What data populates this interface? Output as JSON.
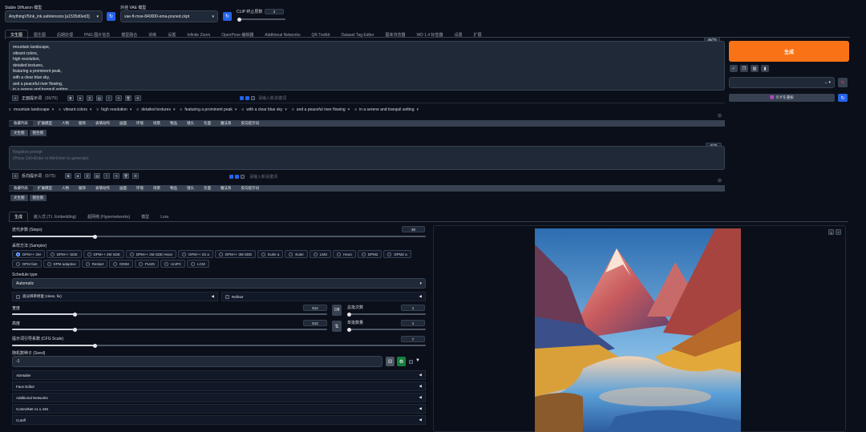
{
  "header": {
    "checkpoint_label": "Stable Diffusion 模型",
    "checkpoint_value": "AnythingV5Ink_ink.safetensors [a1535d0ed3]",
    "vae_label": "外挂 VAE 模型",
    "vae_value": "vae-ft-mse-840000-ema-pruned.ckpt",
    "clip_label": "CLIP 终止层数",
    "clip_value": "2"
  },
  "tabs": [
    "文生图",
    "图生图",
    "后期处理",
    "PNG 图片信息",
    "模型融合",
    "训练",
    "设置",
    "Infinite Zoom",
    "OpenPose 编辑器",
    "Additional Networks",
    "QR Toolkit",
    "Dataset Tag Editor",
    "图库浏览器",
    "WD 1.4 标签器",
    "设置",
    "扩展"
  ],
  "prompt": {
    "counter": "36/75",
    "lines": [
      "mountain landscape,",
      "vibrant colors,",
      "high resolution,",
      "detailed textures,",
      "featuring a prominent peak,",
      "with a clear blue sky,",
      "and a peaceful river flowing,",
      "in a serene and tranquil setting,"
    ],
    "toolbar_label": "正面提示词",
    "toolbar_count": "(36/75)",
    "keyword_placeholder": "请输入新关键词",
    "tokens": [
      "mountain landscape",
      "vibrant colors",
      "high resolution",
      "detailed textures",
      "featuring a prominent peak",
      "with a clear blue sky",
      "and a peaceful river flowing",
      "in a serene and tranquil setting"
    ]
  },
  "categories": [
    "收藏列表",
    "扩展模型",
    "人物",
    "服饰",
    "表情动作",
    "画面",
    "环境",
    "场景",
    "物品",
    "镜头",
    "负面",
    "魔法系",
    "反向提示词"
  ],
  "sub_tabs": [
    "文生图",
    "图生图"
  ],
  "negative": {
    "counter": "0/75",
    "placeholder_line1": "Negative prompt",
    "placeholder_line2": "(Press Ctrl+Enter or Alt+Enter to generate)",
    "toolbar_label": "反向提示词",
    "toolbar_count": "(0/75)",
    "keyword_placeholder": "请输入新关键词"
  },
  "right": {
    "generate": "生成",
    "style_apply": "✓",
    "tag_select": "🟪 タグを選択"
  },
  "param_tabs": [
    "生成",
    "嵌入式 (T.I. Embedding)",
    "超网络 (Hypernetworks)",
    "模型",
    "Lora"
  ],
  "params": {
    "steps_label": "迭代步数 (Steps)",
    "steps_value": "30",
    "steps_frac": 0.2,
    "sampler_label": "采样方法 (Sampler)",
    "samplers": [
      "DPM++ 2M",
      "DPM++ SDE",
      "DPM++ 2M SDE",
      "DPM++ 2M SDE Heun",
      "DPM++ 2S a",
      "DPM++ 3M SDE",
      "Euler a",
      "Euler",
      "LMS",
      "Heun",
      "DPM2",
      "DPM2 a",
      "DPM fast",
      "DPM adaptive",
      "Restart",
      "DDIM",
      "PLMS",
      "UniPC",
      "LCM"
    ],
    "schedule_label": "Schedule type",
    "schedule_value": "Automatic",
    "hires_label": "高分辨率修复 (Hires. fix)",
    "refiner_label": "Refiner",
    "width_label": "宽度",
    "width_value": "512",
    "width_frac": 0.2,
    "height_label": "高度",
    "height_value": "512",
    "height_frac": 0.2,
    "swap_icon": "⇅",
    "batch_count_label": "总批次数",
    "batch_count_value": "1",
    "batch_size_label": "单批数量",
    "batch_size_value": "1",
    "cfg_label": "提示词引导系数 (CFG Scale)",
    "cfg_value": "7",
    "cfg_frac": 0.2,
    "seed_label": "随机数种子 (Seed)",
    "seed_value": "-1",
    "accordions": [
      "ADetailer",
      "Face Editor",
      "Additional Networks",
      "ControlNet v1.1.445",
      "Cutoff"
    ]
  }
}
